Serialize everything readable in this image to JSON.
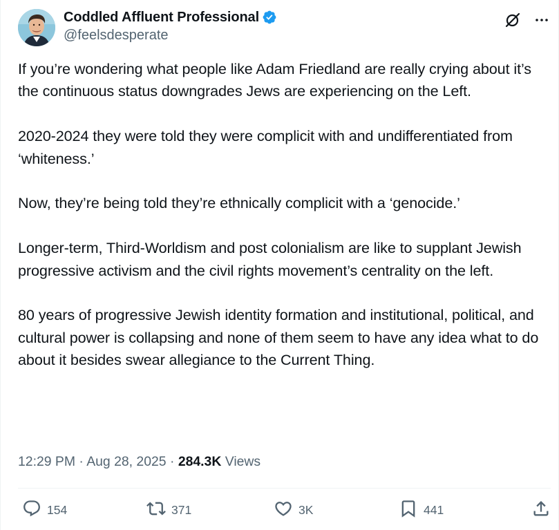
{
  "author": {
    "display_name": "Coddled Affluent Professional",
    "handle": "@feelsdesperate",
    "verified": true
  },
  "tweet": {
    "paragraphs": [
      "If you’re wondering what people like Adam Friedland are really crying about it’s the continuous status downgrades Jews are experiencing on the Left.",
      "2020-2024 they were told they were complicit with and undifferentiated from ‘whiteness.’",
      "Now, they’re being told they’re ethnically complicit with a ‘genocide.’",
      "Longer-term, Third-Worldism and post colonialism are like to supplant Jewish progressive activism and the civil rights movement’s centrality on the left.",
      "80 years of progressive Jewish identity formation and institutional, political, and cultural power is collapsing and none of them seem to have any idea what to do about it besides swear allegiance to the Current Thing."
    ],
    "time": "12:29 PM",
    "separator": "·",
    "date": "Aug 28, 2025",
    "views_count": "284.3K",
    "views_label": "Views"
  },
  "actions": {
    "replies": "154",
    "reposts": "371",
    "likes": "3K",
    "bookmarks": "441"
  },
  "icons": {
    "verified": "verified-badge-icon",
    "grok": "grok-icon",
    "more": "more-icon",
    "reply": "reply-icon",
    "repost": "repost-icon",
    "like": "heart-icon",
    "bookmark": "bookmark-icon",
    "share": "share-icon"
  },
  "colors": {
    "verified_blue": "#1d9bf0",
    "text_primary": "#0f1419",
    "text_secondary": "#536471",
    "divider": "#eff3f4"
  }
}
